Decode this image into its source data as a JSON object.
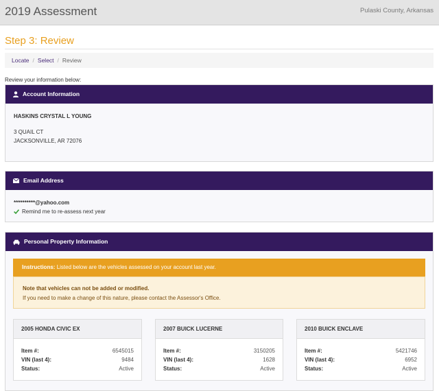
{
  "header": {
    "app_title": "2019 Assessment",
    "county": "Pulaski County, Arkansas"
  },
  "step_title": "Step 3: Review",
  "breadcrumb": {
    "items": [
      "Locate",
      "Select",
      "Review"
    ],
    "separator": "/"
  },
  "intro": "Review your information below:",
  "account": {
    "heading": "Account Information",
    "icon": "user-icon",
    "name": "HASKINS CRYSTAL L YOUNG",
    "address_line1": "3 QUAIL CT",
    "address_line2": "JACKSONVILLE, AR 72076"
  },
  "email": {
    "heading": "Email Address",
    "icon": "envelope-icon",
    "value": "**********@yahoo.com",
    "reminder": "Remind me to re-assess next year",
    "reminder_icon": "check-icon"
  },
  "personal_property": {
    "heading": "Personal Property Information",
    "icon": "car-icon",
    "instructions_label": "Instructions:",
    "instructions_text": "Listed below are the vehicles assessed on your account last year.",
    "note_title": "Note that vehicles can not be added or modified.",
    "note_text": "If you need to make a change of this nature, please contact the Assessor's Office.",
    "vehicles": [
      {
        "title": "2005 HONDA CIVIC EX",
        "item_label": "Item #:",
        "item": "6545015",
        "vin_label": "VIN (last 4):",
        "vin": "9484",
        "status_label": "Status:",
        "status": "Active"
      },
      {
        "title": "2007 BUICK LUCERNE",
        "item_label": "Item #:",
        "item": "3150205",
        "vin_label": "VIN (last 4):",
        "vin": "1628",
        "status_label": "Status:",
        "status": "Active"
      },
      {
        "title": "2010 BUICK ENCLAVE",
        "item_label": "Item #:",
        "item": "5421746",
        "vin_label": "VIN (last 4):",
        "vin": "6952",
        "status_label": "Status:",
        "status": "Active"
      }
    ]
  },
  "colors": {
    "accent_orange": "#e8a020",
    "panel_purple": "#341a5e",
    "link_purple": "#4a2d7a",
    "check_green": "#3aa03a"
  }
}
